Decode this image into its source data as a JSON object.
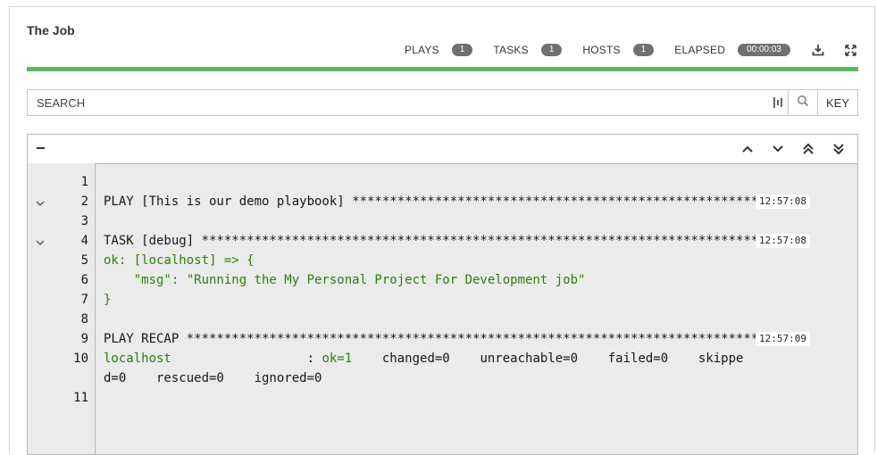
{
  "job": {
    "title": "The Job"
  },
  "stats": {
    "plays_label": "PLAYS",
    "plays_count": "1",
    "tasks_label": "TASKS",
    "tasks_count": "1",
    "hosts_label": "HOSTS",
    "hosts_count": "1",
    "elapsed_label": "ELAPSED",
    "elapsed_value": "00:00:03"
  },
  "icons": {
    "download": "download-icon",
    "fullscreen": "expand-icon",
    "search": "search-icon",
    "filter": "filter-icon",
    "collapse": "minus-icon",
    "scroll_up": "chevron-up-icon",
    "scroll_down": "chevron-down-icon",
    "scroll_top": "double-chevron-up-icon",
    "scroll_bottom": "double-chevron-down-icon"
  },
  "progress": {
    "percent": 100,
    "color": "#5cb85c"
  },
  "search": {
    "placeholder": "SEARCH",
    "key_label": "KEY"
  },
  "colors": {
    "ok_text": "#2f7d0c",
    "output_bg": "#ebebeb"
  },
  "output": {
    "lines": [
      {
        "num": "1",
        "text": "",
        "collapsible": false,
        "time": ""
      },
      {
        "num": "2",
        "text": "PLAY [This is our demo playbook] ***********************************************************",
        "collapsible": true,
        "time": "12:57:08"
      },
      {
        "num": "3",
        "text": "",
        "collapsible": false,
        "time": ""
      },
      {
        "num": "4",
        "text": "TASK [debug] *******************************************************************************",
        "collapsible": true,
        "time": "12:57:08"
      },
      {
        "num": "5",
        "text": "ok: [localhost] => {",
        "collapsible": false,
        "time": "",
        "style": "green"
      },
      {
        "num": "6",
        "text": "    \"msg\": \"Running the My Personal Project For Development job\"",
        "collapsible": false,
        "time": "",
        "style": "green"
      },
      {
        "num": "7",
        "text": "}",
        "collapsible": false,
        "time": "",
        "style": "green"
      },
      {
        "num": "8",
        "text": "",
        "collapsible": false,
        "time": ""
      },
      {
        "num": "9",
        "text": "PLAY RECAP *********************************************************************************",
        "collapsible": false,
        "time": "12:57:09"
      },
      {
        "num": "10",
        "text_host": "localhost",
        "text_sep": "                  : ",
        "text_ok": "ok=1",
        "text_rest": "    changed=0    unreachable=0    failed=0    skippe",
        "collapsible": false,
        "time": ""
      },
      {
        "num": "",
        "text": "d=0    rescued=0    ignored=0",
        "collapsible": false,
        "time": ""
      },
      {
        "num": "11",
        "text": "",
        "collapsible": false,
        "time": ""
      }
    ]
  }
}
